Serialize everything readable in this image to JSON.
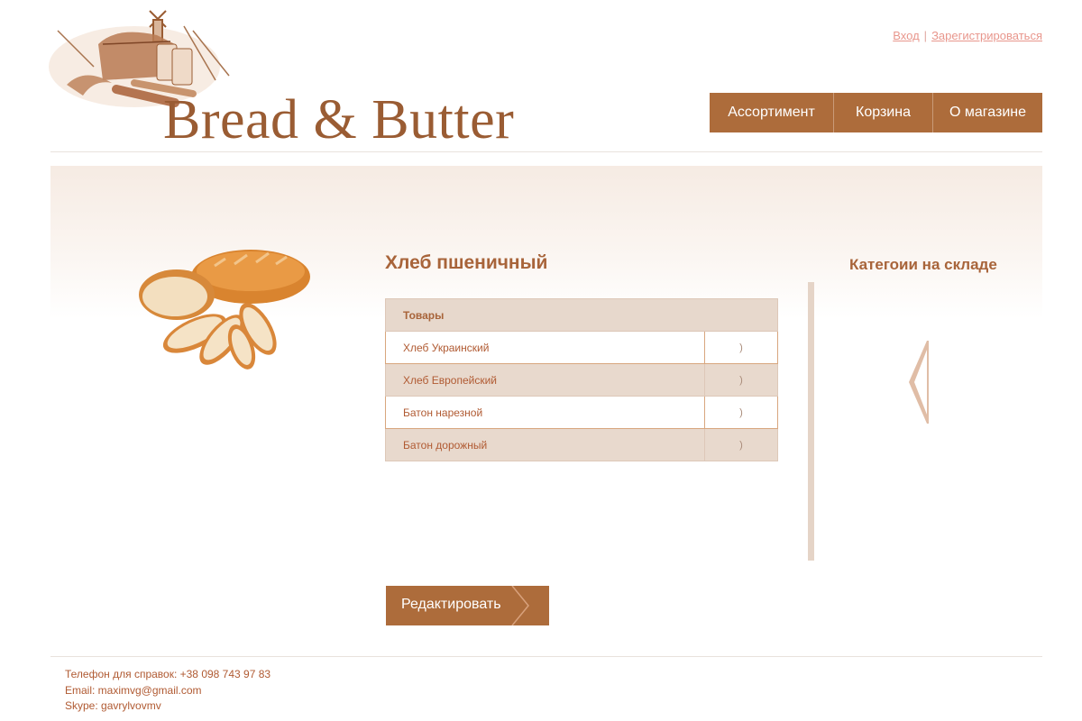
{
  "header": {
    "logo_text": "Bread & Butter",
    "auth": {
      "login": "Вход",
      "separator": "|",
      "register": "Зарегистрироваться"
    },
    "nav": [
      "Ассортимент",
      "Корзина",
      "О магазине"
    ]
  },
  "product": {
    "title": "Хлеб пшеничный",
    "table_header": "Товары",
    "rows": [
      {
        "name": "Хлеб Украинский",
        "arrow": ")"
      },
      {
        "name": "Хлеб Европейский",
        "arrow": ")"
      },
      {
        "name": "Батон нарезной",
        "arrow": ")"
      },
      {
        "name": "Батон дорожный",
        "arrow": ")"
      }
    ],
    "edit_label": "Редактировать"
  },
  "sidebar": {
    "categories_title": "Категоии на складе"
  },
  "footer": {
    "phone": "Телефон для справок: +38 098 743 97 83",
    "email": "Email: maximvg@gmail.com",
    "skype": "Skype: gavrylvovmv"
  },
  "colors": {
    "brand": "#ad6c3b",
    "text_brown": "#a8643a",
    "row_alt": "#e8d9cd",
    "link": "#e8968c"
  },
  "icons": {
    "logo_illustration": "bread-windmill-sketch",
    "product_photo": "wheat-bread-loaf",
    "categories_nav": "chevron-left-icon",
    "edit_chevron": "chevron-right-icon"
  }
}
